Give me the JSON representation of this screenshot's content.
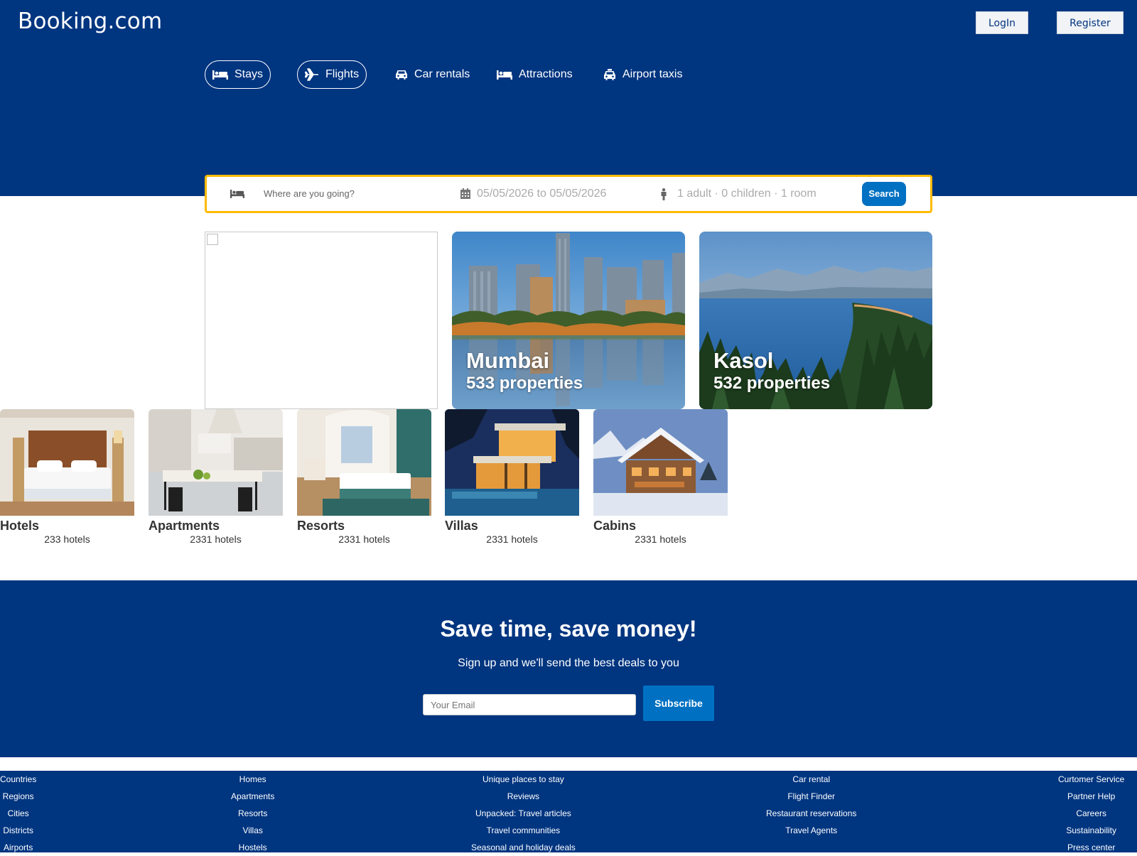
{
  "header": {
    "logo": "Booking.com",
    "login_label": "LogIn",
    "register_label": "Register",
    "nav": [
      {
        "label": "Stays",
        "icon": "bed-icon"
      },
      {
        "label": "Flights",
        "icon": "plane-icon"
      },
      {
        "label": "Car rentals",
        "icon": "car-icon"
      },
      {
        "label": "Attractions",
        "icon": "bed-icon"
      },
      {
        "label": "Airport taxis",
        "icon": "taxi-icon"
      }
    ]
  },
  "search": {
    "destination_placeholder": "Where are you going?",
    "dates": "05/05/2026 to 05/05/2026",
    "guests": "1 adult · 0 children · 1 room",
    "button_label": "Search"
  },
  "destinations": [
    {
      "name": "Mumbai",
      "properties": "533 properties"
    },
    {
      "name": "Kasol",
      "properties": "532 properties"
    }
  ],
  "property_types": [
    {
      "name": "Hotels",
      "count": "233 hotels"
    },
    {
      "name": "Apartments",
      "count": "2331 hotels"
    },
    {
      "name": "Resorts",
      "count": "2331 hotels"
    },
    {
      "name": "Villas",
      "count": "2331 hotels"
    },
    {
      "name": "Cabins",
      "count": "2331 hotels"
    }
  ],
  "newsletter": {
    "title": "Save time, save money!",
    "subtitle": "Sign up and we'll send the best deals to you",
    "email_placeholder": "Your Email",
    "subscribe_label": "Subscribe"
  },
  "footer": {
    "col1": [
      "Countries",
      "Regions",
      "Cities",
      "Districts",
      "Airports"
    ],
    "col2": [
      "Homes",
      "Apartments",
      "Resorts",
      "Villas",
      "Hostels"
    ],
    "col3": [
      "Unique places to stay",
      "Reviews",
      "Unpacked: Travel articles",
      "Travel communities",
      "Seasonal and holiday deals"
    ],
    "col4": [
      "Car rental",
      "Flight Finder",
      "Restaurant reservations",
      "Travel Agents"
    ],
    "col5": [
      "Curtomer Service",
      "Partner Help",
      "Careers",
      "Sustainability",
      "Press center"
    ]
  },
  "colors": {
    "brand_blue": "#003580",
    "action_blue": "#0071c2",
    "search_border": "#febb02"
  }
}
